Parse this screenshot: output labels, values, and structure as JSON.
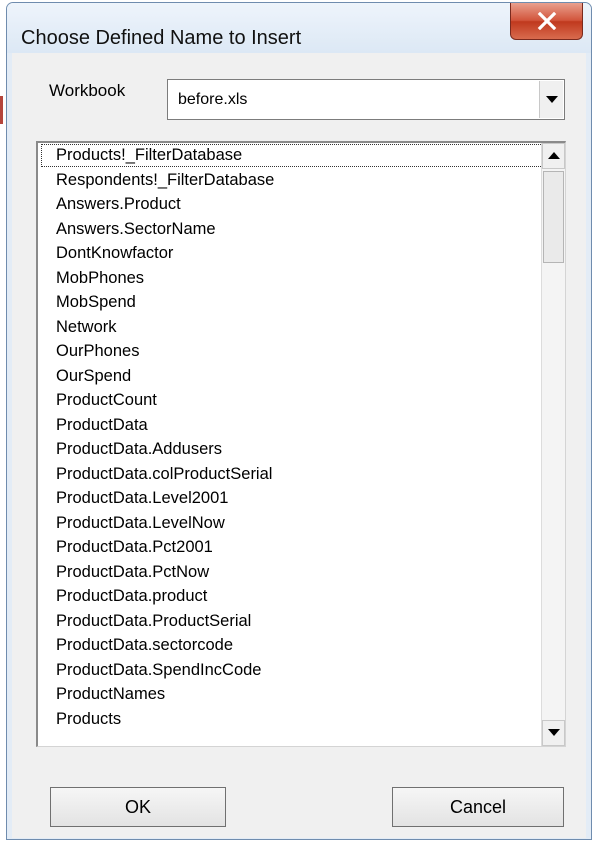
{
  "window": {
    "title": "Choose Defined Name to Insert",
    "close_icon": "close-x-icon",
    "accent_color": "#c7412a"
  },
  "workbook": {
    "label": "Workbook",
    "selected": "before.xls",
    "dropdown_icon": "chevron-down-icon"
  },
  "names_list": {
    "focused_index": 0,
    "items": [
      "Products!_FilterDatabase",
      "Respondents!_FilterDatabase",
      "Answers.Product",
      "Answers.SectorName",
      "DontKnowfactor",
      "MobPhones",
      "MobSpend",
      "Network",
      "OurPhones",
      "OurSpend",
      "ProductCount",
      "ProductData",
      "ProductData.Addusers",
      "ProductData.colProductSerial",
      "ProductData.Level2001",
      "ProductData.LevelNow",
      "ProductData.Pct2001",
      "ProductData.PctNow",
      "ProductData.product",
      "ProductData.ProductSerial",
      "ProductData.sectorcode",
      "ProductData.SpendIncCode",
      "ProductNames",
      "Products"
    ]
  },
  "buttons": {
    "ok": "OK",
    "cancel": "Cancel"
  }
}
